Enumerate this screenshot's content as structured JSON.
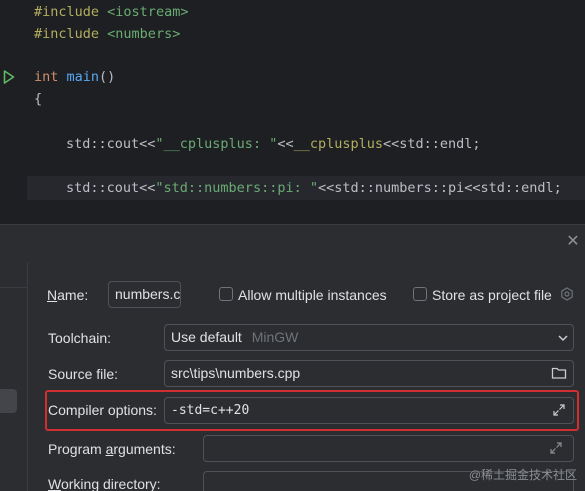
{
  "editor": {
    "lines": {
      "l1_directive": "#include",
      "l1_header": "<iostream>",
      "l2_directive": "#include",
      "l2_header": "<numbers>",
      "l3_type": "int",
      "l3_fn": "main",
      "l3_parens": "()",
      "l4_brace": "{",
      "l5_a": "std::cout<<",
      "l5_str": "\"__cplusplus: \"",
      "l5_b": "<<",
      "l5_mac": "__cplusplus",
      "l5_c": "<<std::endl;",
      "l6_a": "std::cout<<",
      "l6_str": "\"std::numbers::pi: \"",
      "l6_c": "<<std::numbers::pi<<std::endl;"
    }
  },
  "dialog": {
    "name_label": "Name:",
    "name_value": "numbers.c",
    "allow_multiple_label": "Allow multiple instances",
    "store_project_label": "Store as project file",
    "toolchain_label": "Toolchain:",
    "toolchain_value": "Use default",
    "toolchain_hint": "MinGW",
    "source_file_label": "Source file:",
    "source_file_value": "src\\tips\\numbers.cpp",
    "compiler_options_label": "Compiler options:",
    "compiler_options_value": "-std=c++20",
    "program_args_label": "Program arguments:",
    "program_args_value": "",
    "working_dir_label": "Working directory:",
    "working_dir_value": ""
  },
  "watermark": "@稀土掘金技术社区",
  "icons": [
    "run-icon",
    "close-icon",
    "gear-icon",
    "chevron-down-icon",
    "folder-icon",
    "expand-icon"
  ],
  "colors": {
    "highlight": "#d12e32",
    "run_arrow": "#5fb865"
  }
}
